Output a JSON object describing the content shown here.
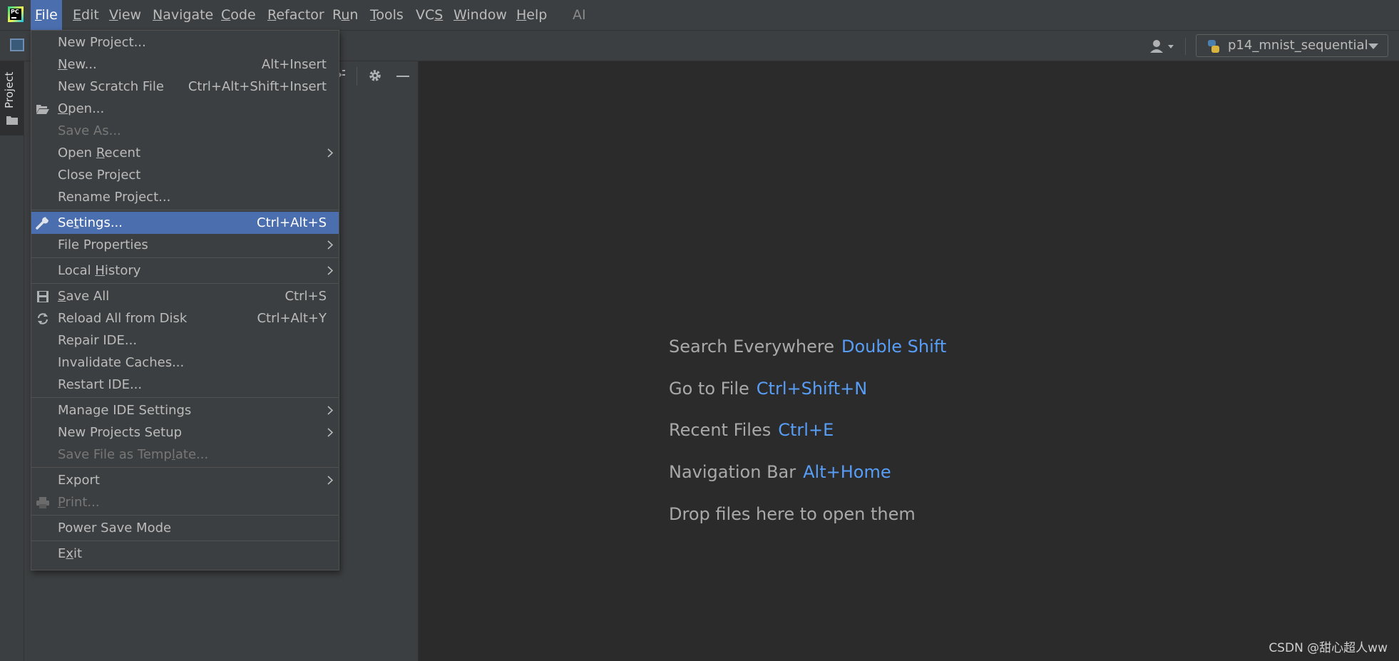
{
  "menubar": {
    "items": [
      {
        "label": "File",
        "u": "F",
        "rest": "ile"
      },
      {
        "label": "Edit",
        "u": "E",
        "rest": "dit"
      },
      {
        "label": "View",
        "u": "V",
        "rest": "iew"
      },
      {
        "label": "Navigate",
        "u": "N",
        "rest": "avigate"
      },
      {
        "label": "Code",
        "u": "C",
        "rest": "ode"
      },
      {
        "label": "Refactor",
        "u": "R",
        "rest": "efactor"
      },
      {
        "label": "Run",
        "pre": "R",
        "u": "u",
        "rest": "n"
      },
      {
        "label": "Tools",
        "u": "T",
        "rest": "ools"
      },
      {
        "label": "VCS",
        "pre": "VC",
        "u": "S",
        "rest": ""
      },
      {
        "label": "Window",
        "u": "W",
        "rest": "indow"
      },
      {
        "label": "Help",
        "u": "H",
        "rest": "elp"
      },
      {
        "label": "AI"
      }
    ]
  },
  "toolbar": {
    "run_config": "p14_mnist_sequential"
  },
  "sidebar": {
    "project_tab": "Project"
  },
  "file_menu": {
    "items": [
      {
        "label": "New Project...",
        "shortcut": ""
      },
      {
        "label_pre": "",
        "label_u": "N",
        "label_rest": "ew...",
        "shortcut": "Alt+Insert"
      },
      {
        "label": "New Scratch File",
        "shortcut": "Ctrl+Alt+Shift+Insert"
      },
      {
        "label_pre": "",
        "label_u": "O",
        "label_rest": "pen...",
        "shortcut": ""
      },
      {
        "label": "Save As...",
        "shortcut": ""
      },
      {
        "label_pre": "Open ",
        "label_u": "R",
        "label_rest": "ecent",
        "shortcut": ""
      },
      {
        "label_pre": "Close Pro",
        "label_u": "j",
        "label_rest": "ect",
        "shortcut": ""
      },
      {
        "label": "Rename Project...",
        "shortcut": ""
      },
      {
        "label_pre": "Se",
        "label_u": "t",
        "label_rest": "tings...",
        "shortcut": "Ctrl+Alt+S"
      },
      {
        "label": "File Properties",
        "shortcut": ""
      },
      {
        "label_pre": "Local ",
        "label_u": "H",
        "label_rest": "istory",
        "shortcut": ""
      },
      {
        "label_pre": "",
        "label_u": "S",
        "label_rest": "ave All",
        "shortcut": "Ctrl+S"
      },
      {
        "label": "Reload All from Disk",
        "shortcut": "Ctrl+Alt+Y"
      },
      {
        "label": "Repair IDE...",
        "shortcut": ""
      },
      {
        "label": "Invalidate Caches...",
        "shortcut": ""
      },
      {
        "label": "Restart IDE...",
        "shortcut": ""
      },
      {
        "label": "Manage IDE Settings",
        "shortcut": ""
      },
      {
        "label": "New Projects Setup",
        "shortcut": ""
      },
      {
        "label_pre": "Save File as Temp",
        "label_u": "l",
        "label_rest": "ate...",
        "shortcut": ""
      },
      {
        "label": "Export",
        "shortcut": ""
      },
      {
        "label_pre": "",
        "label_u": "P",
        "label_rest": "rint...",
        "shortcut": ""
      },
      {
        "label": "Power Save Mode",
        "shortcut": ""
      },
      {
        "label_pre": "E",
        "label_u": "x",
        "label_rest": "it",
        "shortcut": ""
      }
    ]
  },
  "editor": {
    "hints": [
      {
        "text": "Search Everywhere",
        "key": "Double Shift"
      },
      {
        "text": "Go to File",
        "key": "Ctrl+Shift+N"
      },
      {
        "text": "Recent Files",
        "key": "Ctrl+E"
      },
      {
        "text": "Navigation Bar",
        "key": "Alt+Home"
      },
      {
        "text": "Drop files here to open them",
        "key": ""
      }
    ]
  },
  "watermark": "CSDN @甜心超人ww",
  "colors": {
    "accent": "#4b6eaf",
    "link": "#589df6",
    "background": "#2b2b2b",
    "panel": "#3c3f41"
  }
}
